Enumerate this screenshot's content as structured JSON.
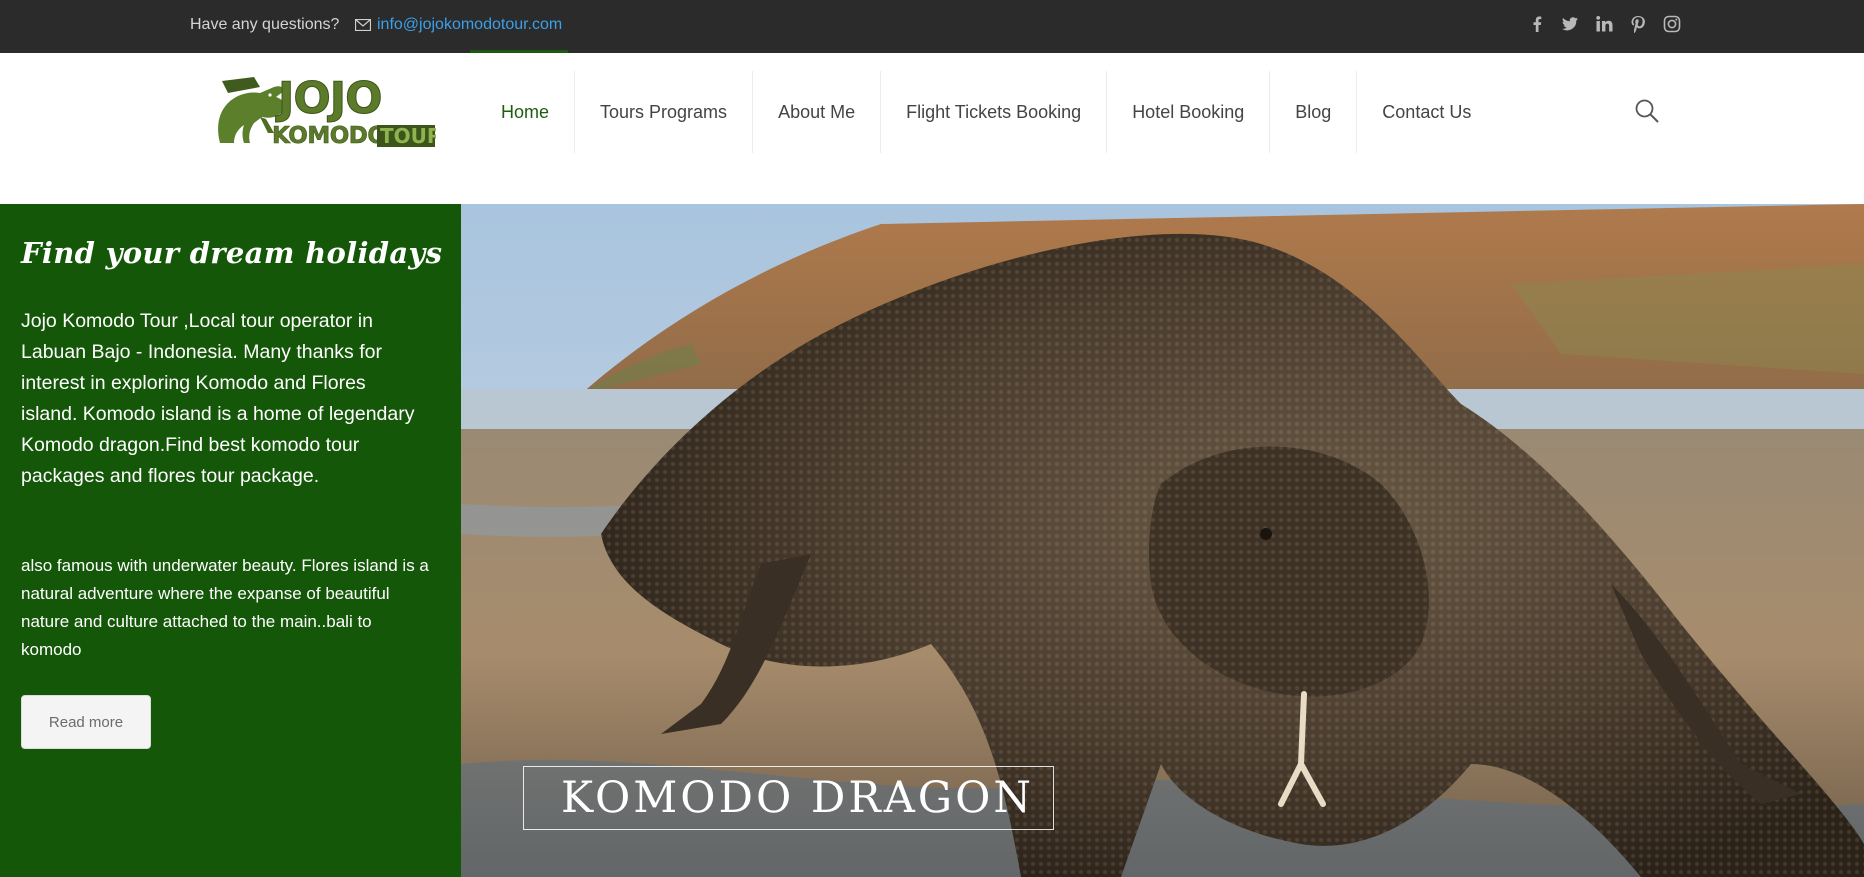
{
  "topbar": {
    "question": "Have any questions?",
    "email": "info@jojokomodotour.com",
    "social_icons": [
      "facebook-icon",
      "twitter-icon",
      "linkedin-icon",
      "pinterest-icon",
      "instagram-icon"
    ]
  },
  "logo": {
    "line1": "JOJO",
    "line2": "KOMODO",
    "line3": "TOUR"
  },
  "nav": {
    "items": [
      {
        "label": "Home",
        "active": true
      },
      {
        "label": "Tours Programs"
      },
      {
        "label": "About Me"
      },
      {
        "label": "Flight Tickets Booking"
      },
      {
        "label": "Hotel Booking"
      },
      {
        "label": "Blog"
      },
      {
        "label": "Contact Us"
      }
    ]
  },
  "hero": {
    "title": "Find your dream holidays",
    "description": "Jojo Komodo Tour ,Local tour operator in Labuan Bajo - Indonesia. Many thanks for interest in exploring Komodo and Flores island. Komodo island is a home of legendary Komodo dragon.Find best komodo tour packages and flores tour package.",
    "extra": "also famous with underwater beauty. Flores island is a natural adventure where the expanse of beautiful nature and culture attached to the main..bali to komodo",
    "button": "Read more",
    "caption": "KOMODO DRAGON"
  },
  "colors": {
    "topbar": "#2b2b2b",
    "link": "#3c9fe8",
    "brand_green": "#145709",
    "nav_active": "#1e5e12"
  }
}
